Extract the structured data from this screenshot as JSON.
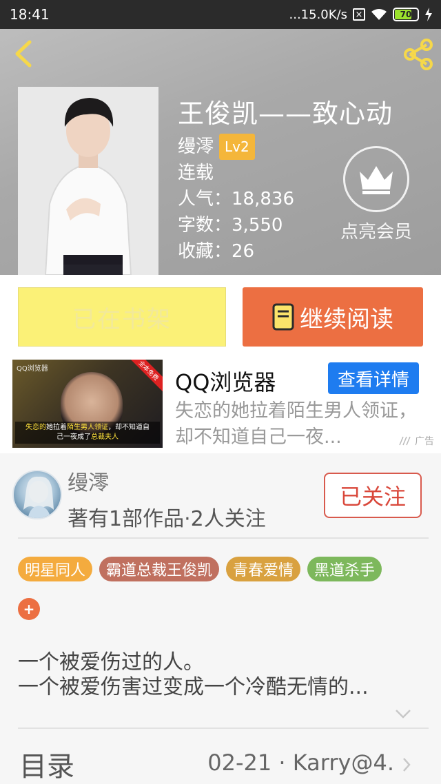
{
  "status_bar": {
    "time": "18:41",
    "network_speed": "...15.0K/s",
    "battery_level": "70",
    "battery_fraction": 0.7
  },
  "book": {
    "title": "王俊凯——致心动",
    "author": "缦澪",
    "author_level": "Lv2",
    "status": "连载",
    "popularity_label": "人气：",
    "popularity": "18,836",
    "word_count_label": "字数：",
    "word_count": "3,550",
    "favorites_label": "收藏：",
    "favorites": "26"
  },
  "vip": {
    "label": "点亮会员",
    "icon": "crown-icon"
  },
  "actions": {
    "shelf_label": "已在书架",
    "read_label": "继续阅读",
    "read_icon": "book-icon"
  },
  "ad": {
    "title": "QQ浏览器",
    "detail_label": "查看详情",
    "description": "失恋的她拉着陌生男人领证，却不知道自己一夜...",
    "tag": "广告",
    "image_logo": "QQ浏览器",
    "image_ribbon": "全本免费",
    "image_caption_a": "失恋的",
    "image_caption_b": "她拉着",
    "image_caption_c": "陌生男人领证",
    "image_caption_d": "，却不知道自",
    "image_caption_e": "己一夜成了",
    "image_caption_f": "总裁夫人"
  },
  "author_card": {
    "name": "缦澪",
    "stats": "著有1部作品·2人关注",
    "follow_label": "已关注"
  },
  "tags": [
    {
      "label": "明星同人",
      "color": "#f4ab3e"
    },
    {
      "label": "霸道总裁王俊凯",
      "color": "#c0705f"
    },
    {
      "label": "青春爱情",
      "color": "#d9a13f"
    },
    {
      "label": "黑道杀手",
      "color": "#7db85c"
    }
  ],
  "add_tag_label": "+",
  "summary": {
    "line1": "一个被爱伤过的人。",
    "line2": "一个被爱伤害过变成一个冷酷无情的..."
  },
  "catalog": {
    "title": "目录",
    "latest": "02-21 · Karry@4."
  },
  "colors": {
    "accent": "#ec6f42",
    "shelf": "#fbf177",
    "ad_button": "#1e7cf0",
    "follow": "#d9473a"
  }
}
